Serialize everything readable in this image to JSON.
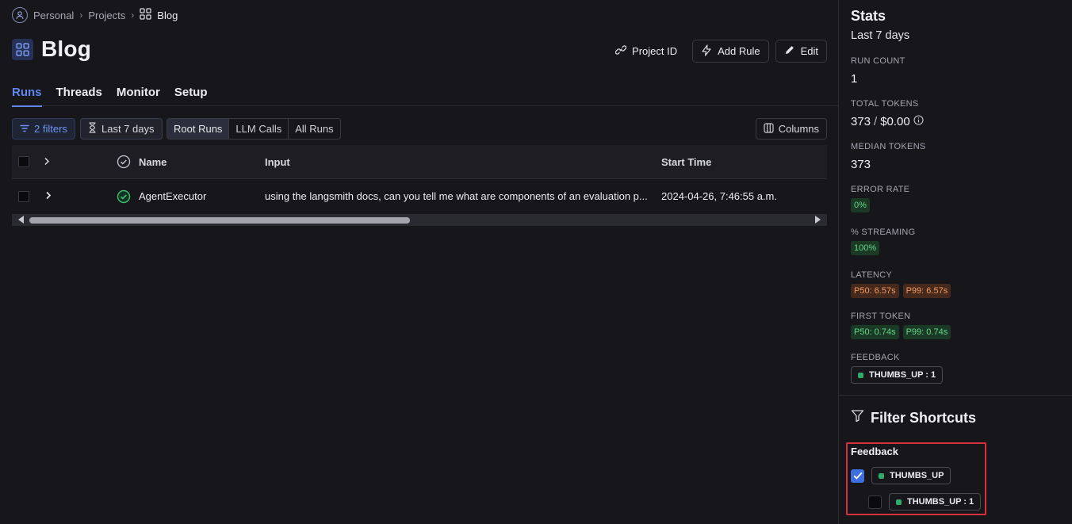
{
  "breadcrumb": {
    "root": "Personal",
    "section": "Projects",
    "current": "Blog"
  },
  "page": {
    "title": "Blog"
  },
  "actions": {
    "project_id": "Project ID",
    "add_rule": "Add Rule",
    "edit": "Edit"
  },
  "tabs": [
    {
      "label": "Runs",
      "active": true
    },
    {
      "label": "Threads",
      "active": false
    },
    {
      "label": "Monitor",
      "active": false
    },
    {
      "label": "Setup",
      "active": false
    }
  ],
  "filters": {
    "filters_label": "2 filters",
    "range_label": "Last 7 days",
    "run_types": [
      "Root Runs",
      "LLM Calls",
      "All Runs"
    ],
    "active_run_type": "Root Runs",
    "columns_label": "Columns"
  },
  "table": {
    "headers": {
      "name": "Name",
      "input": "Input",
      "start_time": "Start Time"
    },
    "rows": [
      {
        "name": "AgentExecutor",
        "input": "using the langsmith docs, can you tell me what are components of an evaluation p...",
        "start_time": "2024-04-26, 7:46:55 a.m.",
        "status": "success"
      }
    ]
  },
  "stats": {
    "title": "Stats",
    "period": "Last 7 days",
    "run_count_label": "RUN COUNT",
    "run_count": "1",
    "total_tokens_label": "TOTAL TOKENS",
    "total_tokens": "373",
    "total_tokens_sep": "/",
    "total_cost": "$0.00",
    "median_tokens_label": "MEDIAN TOKENS",
    "median_tokens": "373",
    "error_rate_label": "ERROR RATE",
    "error_rate": "0%",
    "streaming_label": "% STREAMING",
    "streaming": "100%",
    "latency_label": "LATENCY",
    "latency_p50": "P50: 6.57s",
    "latency_p99": "P99: 6.57s",
    "first_token_label": "FIRST TOKEN",
    "first_token_p50": "P50: 0.74s",
    "first_token_p99": "P99: 0.74s",
    "feedback_label": "FEEDBACK",
    "feedback_tag": "THUMBS_UP : 1"
  },
  "filter_shortcuts": {
    "title": "Filter Shortcuts",
    "group_label": "Feedback",
    "option_key": "THUMBS_UP",
    "option_key_checked": true,
    "option_value": "THUMBS_UP : 1",
    "option_value_checked": false
  },
  "colors": {
    "accent": "#5f87ee",
    "success": "#2eaa6a",
    "highlight": "#d5323d"
  }
}
